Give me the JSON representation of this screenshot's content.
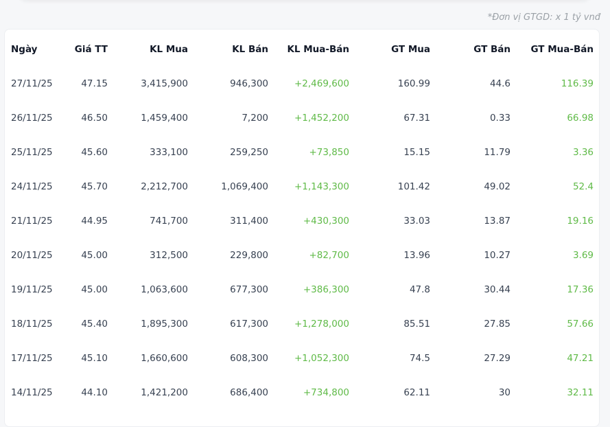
{
  "unit_note": "*Đơn vị GTGD: x 1 tỷ vnđ",
  "columns": [
    "Ngày",
    "Giá TT",
    "KL Mua",
    "KL Bán",
    "KL Mua-Bán",
    "GT Mua",
    "GT Bán",
    "GT Mua-Bán"
  ],
  "rows": [
    [
      "27/11/25",
      "47.15",
      "3,415,900",
      "946,300",
      "+2,469,600",
      "160.99",
      "44.6",
      "116.39"
    ],
    [
      "26/11/25",
      "46.50",
      "1,459,400",
      "7,200",
      "+1,452,200",
      "67.31",
      "0.33",
      "66.98"
    ],
    [
      "25/11/25",
      "45.60",
      "333,100",
      "259,250",
      "+73,850",
      "15.15",
      "11.79",
      "3.36"
    ],
    [
      "24/11/25",
      "45.70",
      "2,212,700",
      "1,069,400",
      "+1,143,300",
      "101.42",
      "49.02",
      "52.4"
    ],
    [
      "21/11/25",
      "44.95",
      "741,700",
      "311,400",
      "+430,300",
      "33.03",
      "13.87",
      "19.16"
    ],
    [
      "20/11/25",
      "45.00",
      "312,500",
      "229,800",
      "+82,700",
      "13.96",
      "10.27",
      "3.69"
    ],
    [
      "19/11/25",
      "45.00",
      "1,063,600",
      "677,300",
      "+386,300",
      "47.8",
      "30.44",
      "17.36"
    ],
    [
      "18/11/25",
      "45.40",
      "1,895,300",
      "617,300",
      "+1,278,000",
      "85.51",
      "27.85",
      "57.66"
    ],
    [
      "17/11/25",
      "45.10",
      "1,660,600",
      "608,300",
      "+1,052,300",
      "74.5",
      "27.29",
      "47.21"
    ],
    [
      "14/11/25",
      "44.10",
      "1,421,200",
      "686,400",
      "+734,800",
      "62.11",
      "30",
      "32.11"
    ]
  ],
  "colors": {
    "positive": "#5fba47",
    "text": "#374151",
    "header": "#111827",
    "note": "#9aa0a6"
  }
}
